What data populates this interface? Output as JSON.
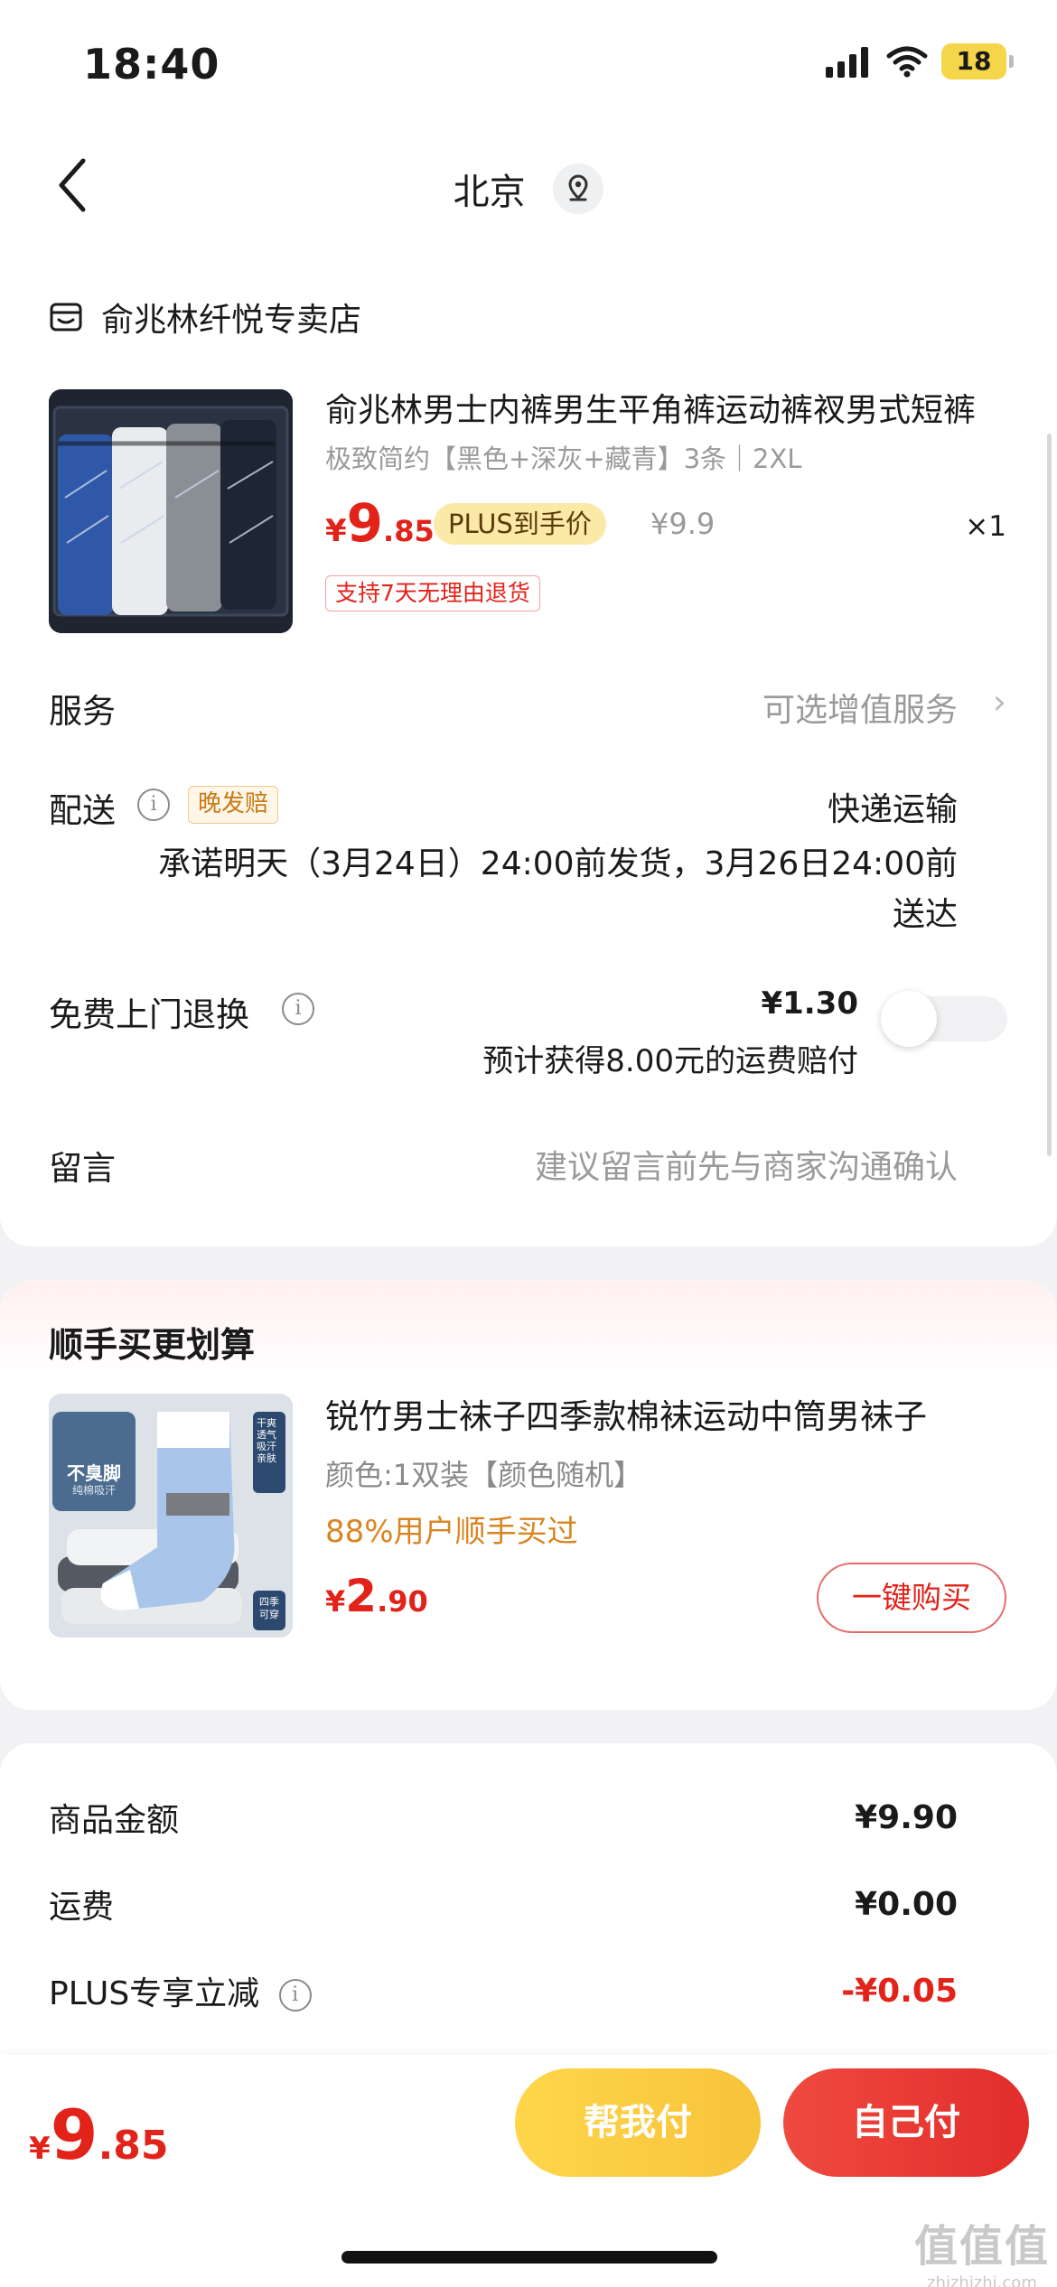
{
  "status_bar": {
    "time": "18:40",
    "battery": "18"
  },
  "nav": {
    "city": "北京"
  },
  "order": {
    "store_name": "俞兆林纤悦专卖店",
    "product": {
      "title": "俞兆林男士内裤男生平角裤运动裤衩男式短裤",
      "spec": "极致简约【黑色+深灰+藏青】3条｜2XL",
      "price_int": "9",
      "price_dec": ".85",
      "currency": "¥",
      "plus_tag": "PLUS到手价",
      "original_price": "¥9.9",
      "quantity": "×1",
      "return_tag": "支持7天无理由退货"
    },
    "service": {
      "label": "服务",
      "value": "可选增值服务"
    },
    "delivery": {
      "label": "配送",
      "tag": "晚发赔",
      "method": "快递运输",
      "promise_line1": "承诺明天（3月24日）24:00前发货，3月26日24:00前",
      "promise_line2": "送达"
    },
    "free_return": {
      "label": "免费上门退换",
      "price": "¥1.30",
      "note": "预计获得8.00元的运费赔付",
      "enabled": false
    },
    "message": {
      "label": "留言",
      "placeholder": "建议留言前先与商家沟通确认"
    }
  },
  "addon": {
    "section_title": "顺手买更划算",
    "product": {
      "title": "锐竹男士袜子四季款棉袜运动中筒男袜子",
      "spec": "颜色:1双装【颜色随机】",
      "bought": "88%用户顺手买过",
      "price_int": "2",
      "price_dec": ".90",
      "currency": "¥",
      "button": "一键购买",
      "image_text_1": "不臭脚",
      "image_text_2": "纯棉吸汗",
      "image_text_3": "四季可穿",
      "image_text_4": "干爽透气 吸汗亲肤"
    }
  },
  "summary": {
    "rows": [
      {
        "label": "商品金额",
        "value": "¥9.90"
      },
      {
        "label": "运费",
        "value": "¥0.00"
      },
      {
        "label": "PLUS专享立减",
        "value": "-¥0.05"
      }
    ]
  },
  "bottom": {
    "currency": "¥",
    "price_int": "9",
    "price_dec": ".85",
    "help_pay": "帮我付",
    "self_pay": "自己付"
  },
  "watermark": {
    "line1": "值值值",
    "line2": "zhizhizhi.com"
  },
  "colors": {
    "accent_red": "#e2231a",
    "plus_gold": "#fbe9a8",
    "help_yellow": "#f7c33a"
  }
}
